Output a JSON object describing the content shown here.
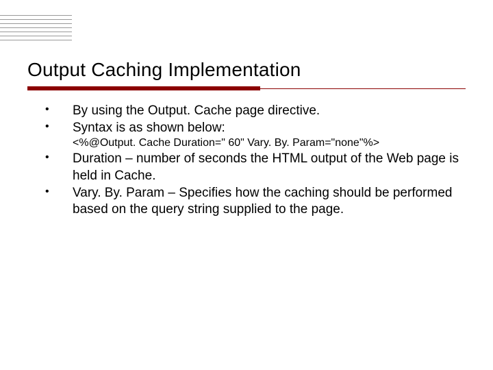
{
  "slide": {
    "title": "Output Caching Implementation",
    "bullets": {
      "b1": "By using the Output. Cache page directive.",
      "b2": "Syntax is as shown below:",
      "code": "<%@Output. Cache Duration=\" 60\" Vary. By. Param=\"none\"%>",
      "b3": " Duration – number of seconds the HTML output of the Web page is held in Cache.",
      "b4": "Vary. By. Param – Specifies how the caching should be performed based on the query string supplied to the page."
    }
  }
}
